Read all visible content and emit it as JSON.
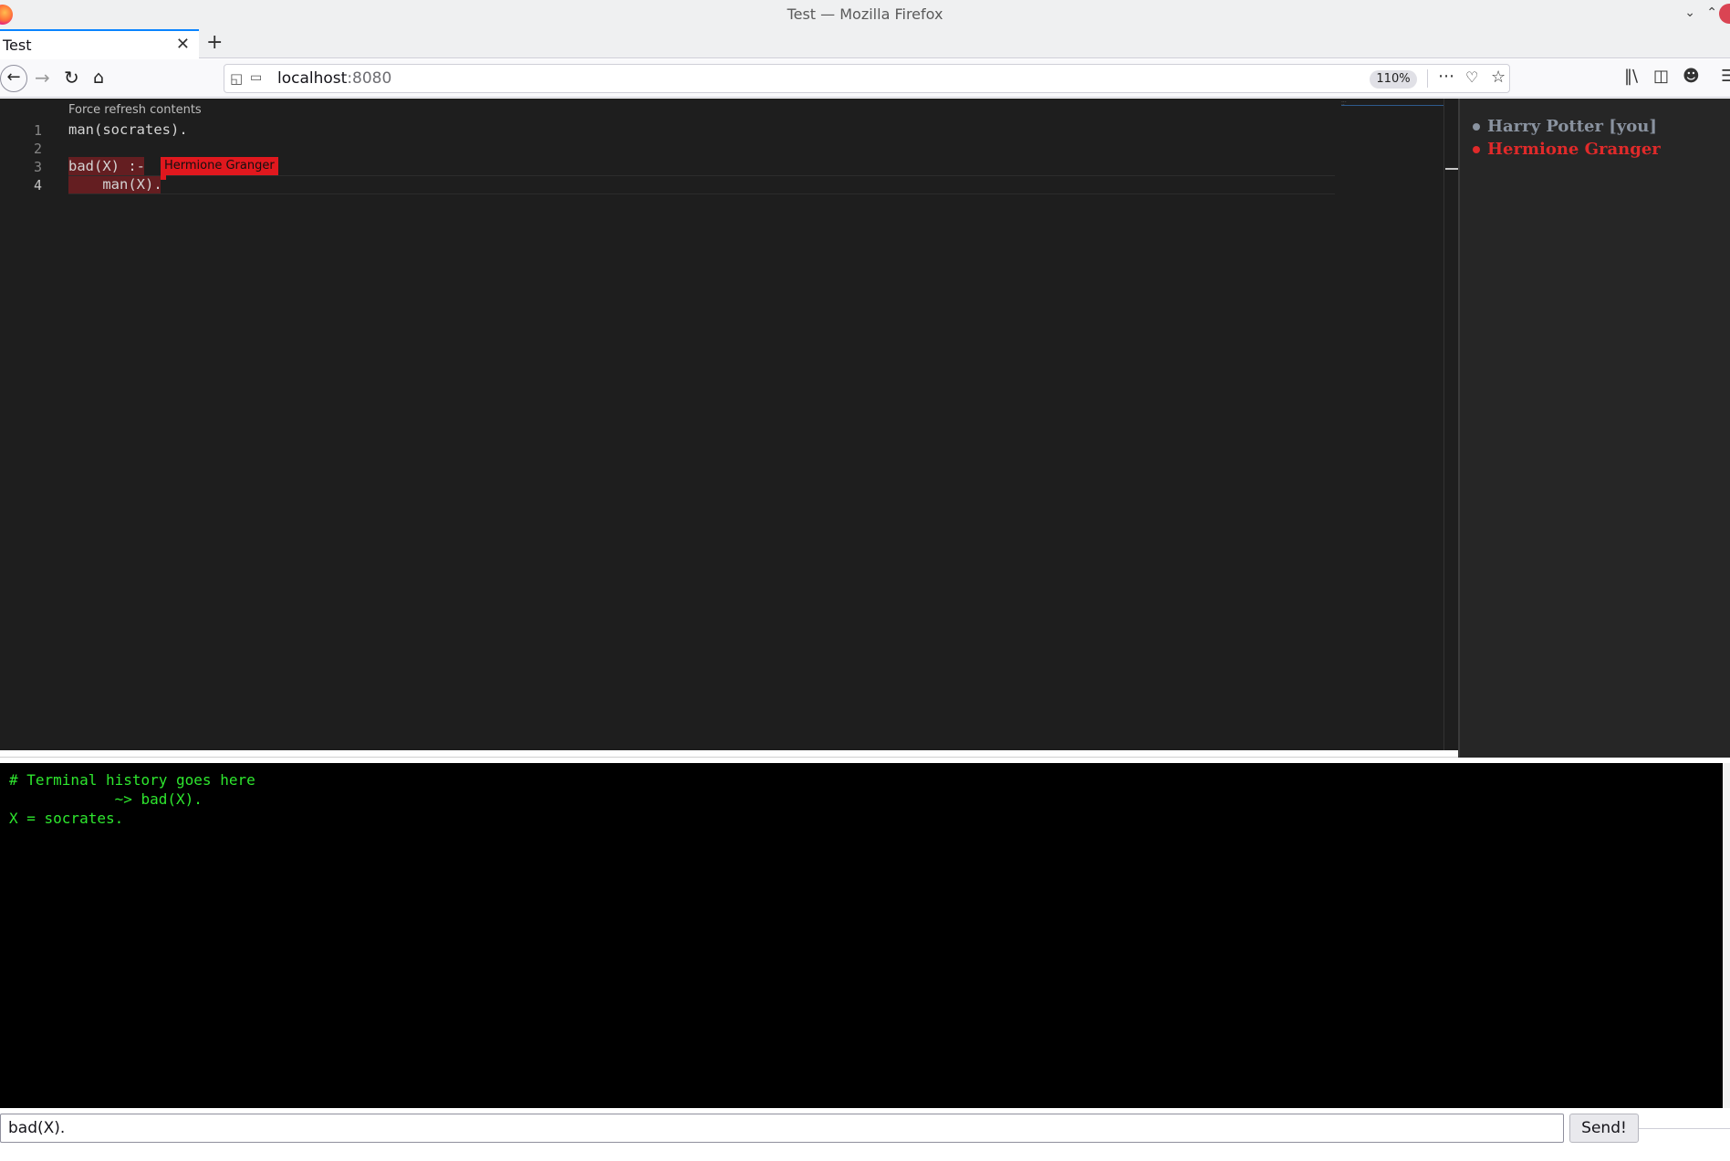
{
  "browser": {
    "window_title": "Test — Mozilla Firefox",
    "tab_title": "Test",
    "new_tab_symbol": "+",
    "url_host": "localhost",
    "url_port": ":8080",
    "zoom": "110%"
  },
  "editor": {
    "force_refresh_label": "Force refresh contents",
    "lines": [
      {
        "num": "1",
        "text": "man(socrates)."
      },
      {
        "num": "2",
        "text": ""
      },
      {
        "num": "3",
        "text": "bad(X) :-"
      },
      {
        "num": "4",
        "text": "    man(X)."
      }
    ],
    "remote_cursor_label": "Hermione Granger",
    "remote_color": "#e0181e"
  },
  "users": [
    {
      "name": "Harry Potter [you]",
      "color": "#8a93a0"
    },
    {
      "name": "Hermione Granger",
      "color": "#e02a2a"
    }
  ],
  "terminal": {
    "lines": [
      "# Terminal history goes here",
      "            ~> bad(X).",
      "X = socrates."
    ],
    "text_color": "#2ee62e"
  },
  "input": {
    "value": "bad(X).",
    "send_label": "Send!"
  }
}
